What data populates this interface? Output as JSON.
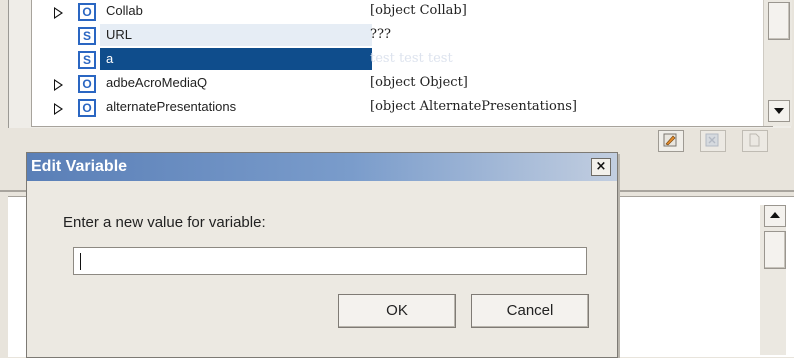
{
  "variables": [
    {
      "expandable": true,
      "type": "O",
      "name": "Collab",
      "value": "[object Collab]",
      "selected": false
    },
    {
      "expandable": false,
      "type": "S",
      "name": "URL",
      "value": "???",
      "selected": false
    },
    {
      "expandable": false,
      "type": "S",
      "name": "a",
      "value": "test test test",
      "selected": true
    },
    {
      "expandable": true,
      "type": "O",
      "name": "adbeAcroMediaQ",
      "value": "[object Object]",
      "selected": false
    },
    {
      "expandable": true,
      "type": "O",
      "name": "alternatePresentations",
      "value": "[object AlternatePresentations]",
      "selected": false
    }
  ],
  "toolbar_icons": [
    "edit-icon",
    "disabled-delete-icon",
    "disabled-new-icon"
  ],
  "dialog": {
    "title": "Edit Variable",
    "close_glyph": "×",
    "prompt": "Enter a new value for variable:",
    "input_value": "",
    "ok_label": "OK",
    "cancel_label": "Cancel"
  },
  "colors": {
    "selection": "#0f4d8c",
    "title_bar_start": "#5a7fb7",
    "type_badge": "#2a66c2"
  }
}
